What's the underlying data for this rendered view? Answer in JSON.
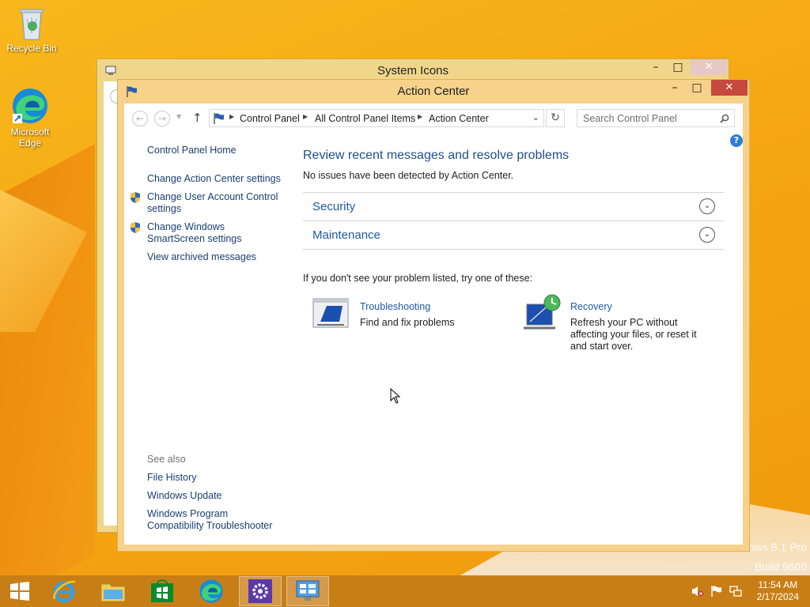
{
  "desktop": {
    "icons": [
      {
        "label": "Recycle Bin"
      },
      {
        "label": "Microsoft Edge"
      }
    ],
    "watermark_line1": "ows 8.1 Pro",
    "watermark_line2": "Build 9600"
  },
  "back_window": {
    "title": "System Icons"
  },
  "window": {
    "title": "Action Center",
    "address": {
      "crumbs": [
        "Control Panel",
        "All Control Panel Items",
        "Action Center"
      ]
    },
    "search": {
      "placeholder": "Search Control Panel"
    },
    "left_pane": {
      "home": "Control Panel Home",
      "links": [
        "Change Action Center settings",
        "Change User Account Control settings",
        "Change Windows SmartScreen settings",
        "View archived messages"
      ],
      "see_also_heading": "See also",
      "see_also": [
        "File History",
        "Windows Update",
        "Windows Program Compatibility Troubleshooter"
      ]
    },
    "main": {
      "title": "Review recent messages and resolve problems",
      "status": "No issues have been detected by Action Center.",
      "sections": [
        "Security",
        "Maintenance"
      ],
      "hint": "If you don't see your problem listed, try one of these:",
      "options": [
        {
          "title": "Troubleshooting",
          "desc": "Find and fix problems"
        },
        {
          "title": "Recovery",
          "desc": "Refresh your PC without affecting your files, or reset it and start over."
        }
      ]
    }
  },
  "taskbar": {
    "apps": [
      "start",
      "internet-explorer",
      "file-explorer",
      "store",
      "edge",
      "settings",
      "control-panel"
    ],
    "time": "11:54 AM",
    "date": "2/17/2024"
  }
}
